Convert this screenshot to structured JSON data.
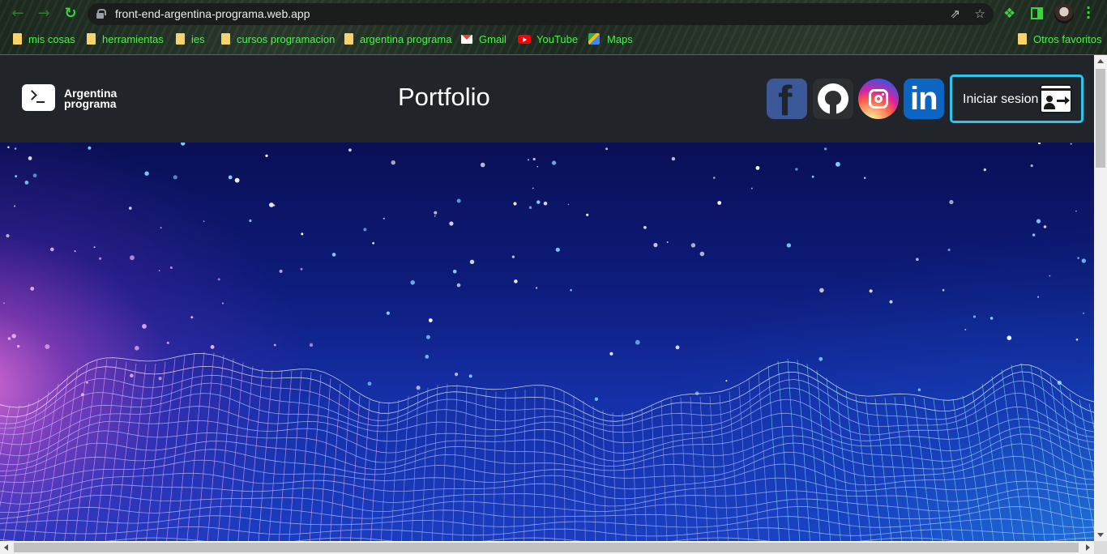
{
  "browser": {
    "url": "front-end-argentina-programa.web.app",
    "bookmarks": [
      {
        "label": "mis cosas",
        "icon": "folder-icon"
      },
      {
        "label": "herramientas",
        "icon": "folder-icon"
      },
      {
        "label": "ies",
        "icon": "folder-icon"
      },
      {
        "label": "cursos programacion",
        "icon": "folder-icon"
      },
      {
        "label": "argentina programa",
        "icon": "folder-icon"
      },
      {
        "label": "Gmail",
        "icon": "gmail-icon"
      },
      {
        "label": "YouTube",
        "icon": "youtube-icon"
      },
      {
        "label": "Maps",
        "icon": "maps-icon"
      }
    ],
    "other_bookmarks": "Otros favoritos",
    "accent_color": "#3fd143"
  },
  "site": {
    "logo_line1": "Argentina",
    "logo_line2": "programa",
    "title": "Portfolio",
    "social": [
      {
        "name": "facebook",
        "icon": "facebook-icon",
        "glyph": "f",
        "color": "#3b5998"
      },
      {
        "name": "github",
        "icon": "github-icon",
        "color": "#2d2f31"
      },
      {
        "name": "instagram",
        "icon": "instagram-icon"
      },
      {
        "name": "linkedin",
        "icon": "linkedin-icon",
        "glyph": "in",
        "color": "#0a66c2"
      }
    ],
    "login_label": "Iniciar sesion",
    "login_border_color": "#2bc6f0",
    "header_bg": "#212529"
  }
}
